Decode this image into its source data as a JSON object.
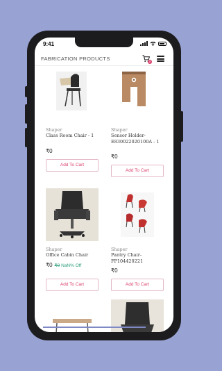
{
  "status_bar": {
    "time": "9:41"
  },
  "header": {
    "title": "FABRICATION PRODUCTS",
    "cart_count": "0"
  },
  "products": [
    {
      "brand": "Shaper",
      "name": "Class Room Chair - 1",
      "price": "₹0",
      "mrp": "",
      "discount": "",
      "button": "Add To Cart"
    },
    {
      "brand": "Shaper",
      "name": "Sensor Holder-E830022020100A - 1",
      "price": "₹0",
      "mrp": "",
      "discount": "",
      "button": "Add To Cart"
    },
    {
      "brand": "Shaper",
      "name": "Office Cabin Chair",
      "price": "₹0",
      "mrp": "₹0",
      "discount": "NaN% Off",
      "button": "Add To Cart"
    },
    {
      "brand": "Shaper",
      "name": "Pantry Chair-FP104420221",
      "price": "₹0",
      "mrp": "",
      "discount": "",
      "button": "Add To Cart"
    }
  ],
  "icons": [
    "cart-icon",
    "hamburger-menu-icon",
    "signal-icon",
    "wifi-icon",
    "battery-icon"
  ],
  "colors": {
    "background": "#99A3D3",
    "accent": "#d9426e",
    "discount": "#2a9d7a"
  }
}
